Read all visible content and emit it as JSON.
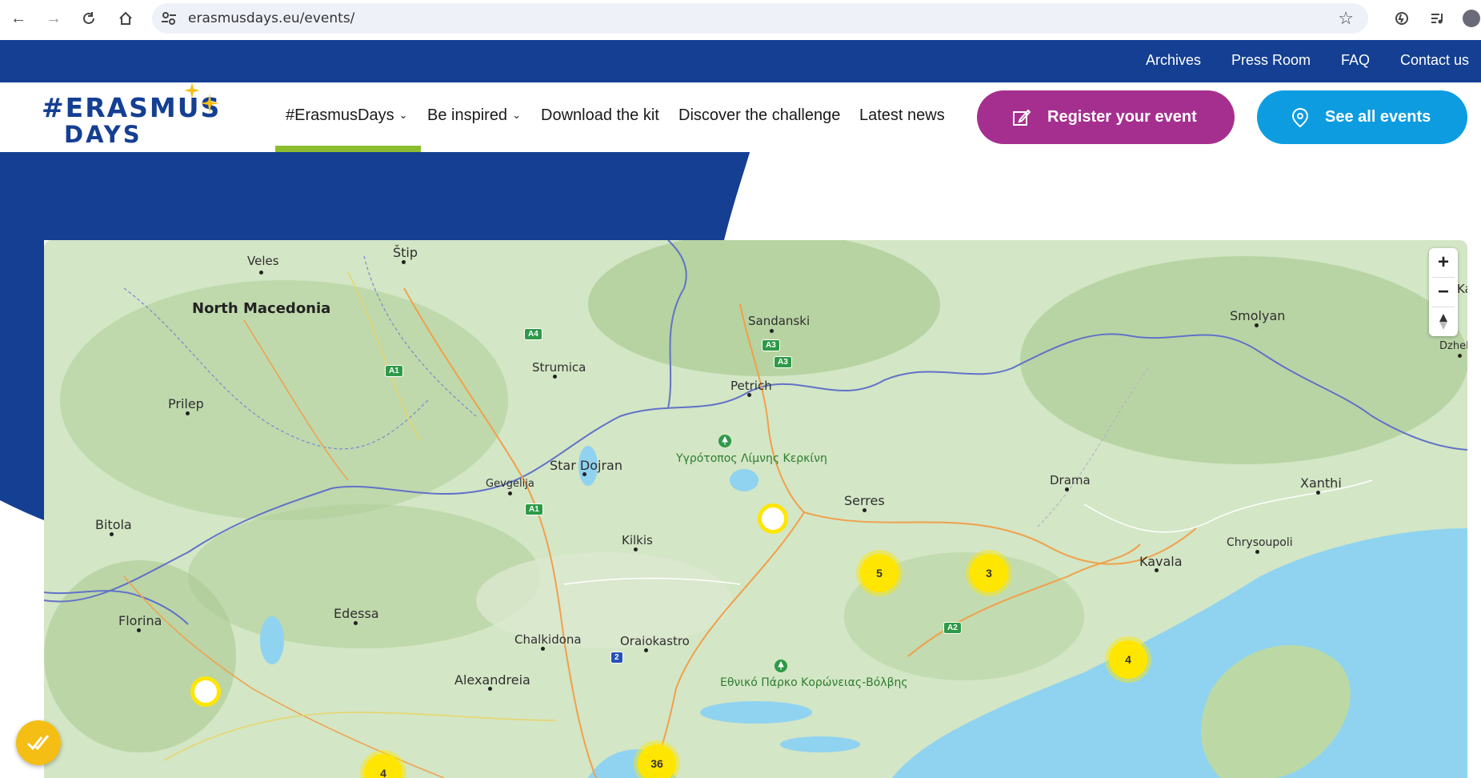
{
  "browser": {
    "url": "erasmusdays.eu/events/"
  },
  "topbar": {
    "links": [
      "Archives",
      "Press Room",
      "FAQ",
      "Contact us"
    ]
  },
  "logo": {
    "line1": "#ERASMUS",
    "line2": "DAYS"
  },
  "nav": {
    "items": [
      "#ErasmusDays",
      "Be inspired",
      "Download the kit",
      "Discover the challenge",
      "Latest news"
    ]
  },
  "buttons": {
    "register": "Register your event",
    "all_events": "See all events"
  },
  "colors": {
    "brand_blue": "#143f92",
    "register_purple": "#a52f8e",
    "events_blue": "#0d9ce0",
    "active_underline": "#8cbd2f",
    "cluster_yellow": "#ffe600"
  },
  "map": {
    "places": {
      "veles": "Veles",
      "stip": "Štip",
      "north_macedonia": "North Macedonia",
      "prilep": "Prilep",
      "strumica": "Strumica",
      "sandanski": "Sandanski",
      "petrich": "Petrich",
      "smolyan": "Smolyan",
      "ka": "Ka",
      "dzhe": "Dzhel",
      "ygrotopos": "Υγρότοπος Λίμνης Κερκίνη",
      "star_dojran": "Star Dojran",
      "gevgelija": "Gevgelija",
      "bitola": "Bitola",
      "kilkis": "Kilkis",
      "serres": "Serres",
      "drama": "Drama",
      "xanthi": "Xanthi",
      "chrysoupoli": "Chrysoupoli",
      "kavala": "Kavala",
      "florina": "Florina",
      "edessa": "Edessa",
      "chalkidona": "Chalkidona",
      "oraiokastro": "Oraiokastro",
      "alexandreia": "Alexandreia",
      "ethniko": "Εθνικό Πάρκο Κορώνειας-Βόλβης"
    },
    "roads": [
      "A4",
      "A1",
      "A3",
      "A3",
      "A1",
      "A2",
      "2"
    ],
    "clusters": [
      "5",
      "3",
      "4",
      "36",
      "4"
    ],
    "zoom_in": "+",
    "zoom_out": "−"
  }
}
